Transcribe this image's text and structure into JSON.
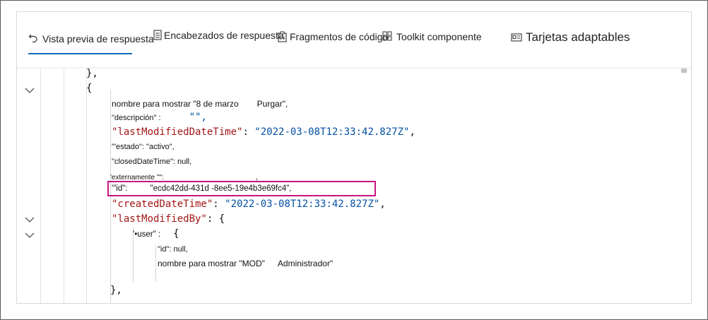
{
  "tabs": [
    {
      "label": "Vista previa de respuesta",
      "icon": "undo-arrow-icon"
    },
    {
      "label": "Encabezados de respuesta",
      "icon": "document-list-icon"
    },
    {
      "label": "Fragmentos de código",
      "icon": "code-snippet-icon"
    },
    {
      "label": "Toolkit componente",
      "icon": "component-grid-icon"
    },
    {
      "label": "Tarjetas adaptables",
      "icon": "card-icon"
    }
  ],
  "active_tab": "Vista previa de respuesta",
  "code": {
    "l1": "},",
    "l2": "{",
    "l3a": "nombre para mostrar \"8 de marzo",
    "l3b": "Purgar\",",
    "l4a": "\"descripción\" :",
    "l4b": "\"\",",
    "l5k": "\"lastModifiedDateTime\"",
    "l5c": ": ",
    "l5v": "\"2022-03-08T12:33:42.827Z\"",
    "l5e": ",",
    "l6": "'\"estado\": \"activo\",",
    "l7": "\"closedDateTime\": null,",
    "l8a": "'externamente \"\":",
    "l8b": ",",
    "l9a": "'\"id\":",
    "l9b": "\"ecdc42dd-431d -8ee5-19e4b3e69fc4\",",
    "l10k": "\"createdDateTime\"",
    "l10c": ": ",
    "l10v": "\"2022-03-08T12:33:42.827Z\"",
    "l10e": ",",
    "l11k": "\"lastModifiedBy\"",
    "l11c": ": {",
    "l12a": "'•user\" :",
    "l12b": "{",
    "l13": "\"id\": null,",
    "l14a": "nombre para mostrar \"MOD\"",
    "l14b": "Administrador\"",
    "l15": "},"
  },
  "colors": {
    "key": "#a31515",
    "string": "#0451a5",
    "highlight_border": "#c8147e",
    "active_tab_underline": "#0f6cbd"
  }
}
